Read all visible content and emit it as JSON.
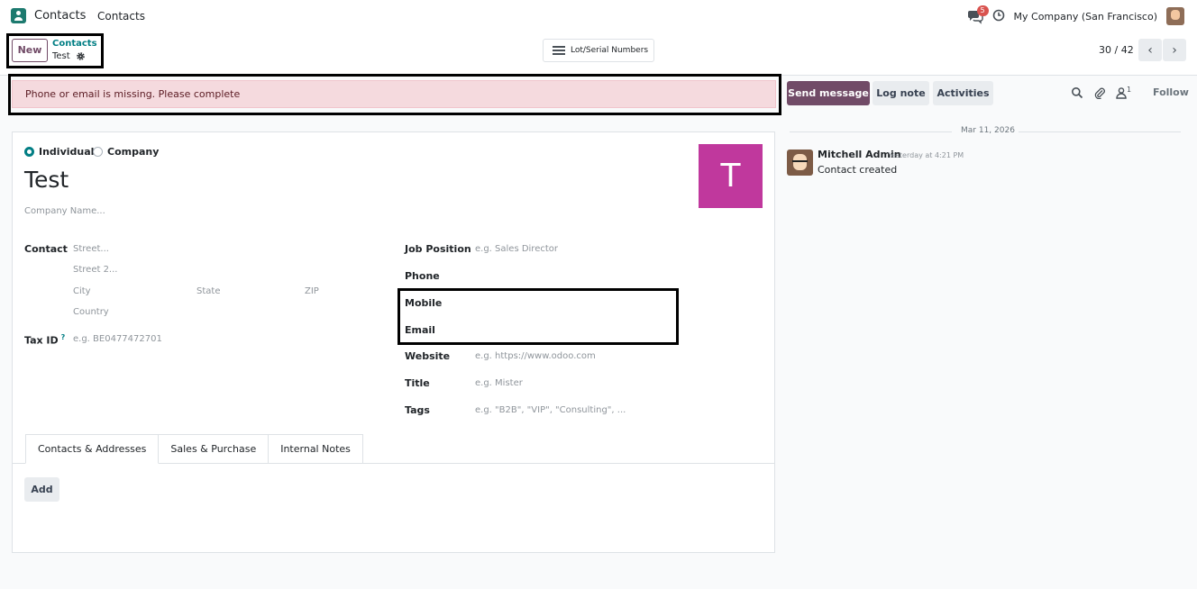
{
  "navbar": {
    "app_name": "Contacts",
    "menu_item": "Contacts",
    "message_count": "5",
    "company": "My Company (San Francisco)"
  },
  "control_panel": {
    "new_label": "New",
    "breadcrumb_parent": "Contacts",
    "breadcrumb_current": "Test",
    "lot_serial_label": "Lot/Serial Numbers",
    "pager": "30 / 42"
  },
  "alert": {
    "text": "Phone or email is missing. Please complete"
  },
  "form": {
    "type_options": [
      "Individual",
      "Company"
    ],
    "selected_type": "Individual",
    "name": "Test",
    "company_placeholder": "Company Name...",
    "avatar_letter": "T",
    "avatar_color": "#c0389d",
    "contact_label": "Contact",
    "street_placeholder": "Street...",
    "street2_placeholder": "Street 2...",
    "city_placeholder": "City",
    "state_placeholder": "State",
    "zip_placeholder": "ZIP",
    "country_placeholder": "Country",
    "tax_label": "Tax ID",
    "tax_help": "?",
    "tax_placeholder": "e.g. BE0477472701",
    "job_label": "Job Position",
    "job_placeholder": "e.g. Sales Director",
    "phone_label": "Phone",
    "mobile_label": "Mobile",
    "email_label": "Email",
    "website_label": "Website",
    "website_placeholder": "e.g. https://www.odoo.com",
    "title_label": "Title",
    "title_placeholder": "e.g. Mister",
    "tags_label": "Tags",
    "tags_placeholder": "e.g. \"B2B\", \"VIP\", \"Consulting\", ..."
  },
  "notebook": {
    "tabs": [
      "Contacts & Addresses",
      "Sales & Purchase",
      "Internal Notes"
    ],
    "active_tab": "Contacts & Addresses",
    "add_label": "Add"
  },
  "chatter": {
    "send_message": "Send message",
    "log_note": "Log note",
    "activities": "Activities",
    "follower_count": "1",
    "follow": "Follow",
    "date": "Mar 11, 2026",
    "messages": [
      {
        "author": "Mitchell Admin",
        "time": "Yesterday at 4:21 PM",
        "body": "Contact created"
      }
    ]
  },
  "colors": {
    "brand": "#714b67",
    "accent": "#017e84",
    "alert_bg": "#f5dade"
  }
}
